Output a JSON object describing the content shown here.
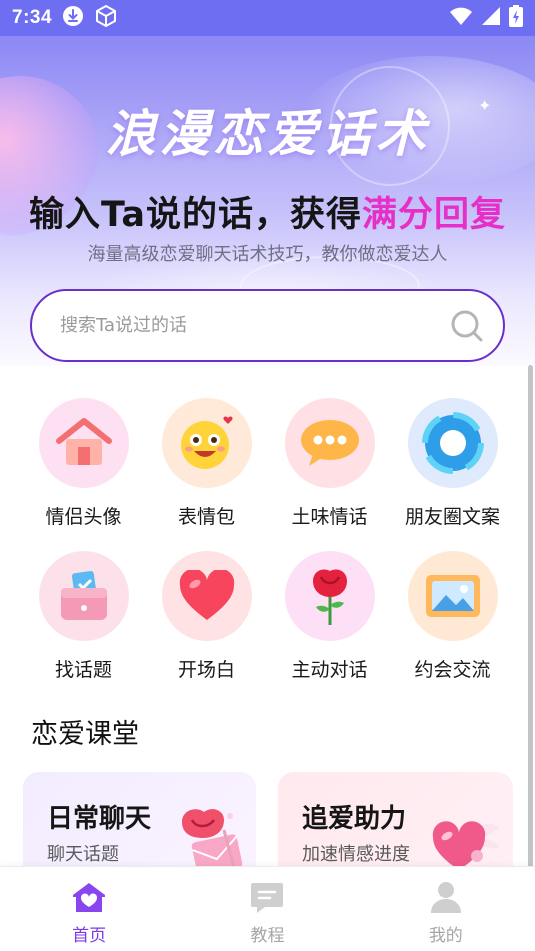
{
  "status_bar": {
    "time": "7:34",
    "icons": [
      "download-icon",
      "cube-icon",
      "wifi-icon",
      "signal-icon",
      "battery-icon"
    ]
  },
  "hero": {
    "title": "浪漫恋爱话术",
    "subtitle_prefix": "输入Ta说的话，获得",
    "subtitle_highlight": "满分回复",
    "description": "海量高级恋爱聊天话术技巧，教你做恋爱达人"
  },
  "search": {
    "placeholder": "搜索Ta说过的话",
    "icon": "search-icon"
  },
  "categories": [
    {
      "label": "情侣头像",
      "icon": "house-icon",
      "bg": "#fde1f2"
    },
    {
      "label": "表情包",
      "icon": "emoji-face-icon",
      "bg": "#ffe9d8"
    },
    {
      "label": "土味情话",
      "icon": "speech-bubble-icon",
      "bg": "#ffe0e4"
    },
    {
      "label": "朋友圈文案",
      "icon": "aperture-icon",
      "bg": "#dfeafd"
    },
    {
      "label": "找话题",
      "icon": "wallet-icon",
      "bg": "#fde1ea"
    },
    {
      "label": "开场白",
      "icon": "heart-icon",
      "bg": "#ffe2e4"
    },
    {
      "label": "主动对话",
      "icon": "rose-icon",
      "bg": "#fde0f6"
    },
    {
      "label": "约会交流",
      "icon": "picture-icon",
      "bg": "#ffe9d5"
    }
  ],
  "section": {
    "title": "恋爱课堂"
  },
  "cards": [
    {
      "title": "日常聊天",
      "subtitle": "聊天话题",
      "icon": "rose-envelope-icon"
    },
    {
      "title": "追爱助力",
      "subtitle": "加速情感进度",
      "icon": "winged-heart-icon"
    }
  ],
  "bottom_nav": [
    {
      "label": "首页",
      "icon": "home-icon",
      "active": true
    },
    {
      "label": "教程",
      "icon": "message-icon",
      "active": false
    },
    {
      "label": "我的",
      "icon": "user-icon",
      "active": false
    }
  ],
  "colors": {
    "accent": "#7c3ae6",
    "highlight": "#e62ec8",
    "status_bar": "#6d6ef2",
    "search_border": "#6a2fc8"
  }
}
